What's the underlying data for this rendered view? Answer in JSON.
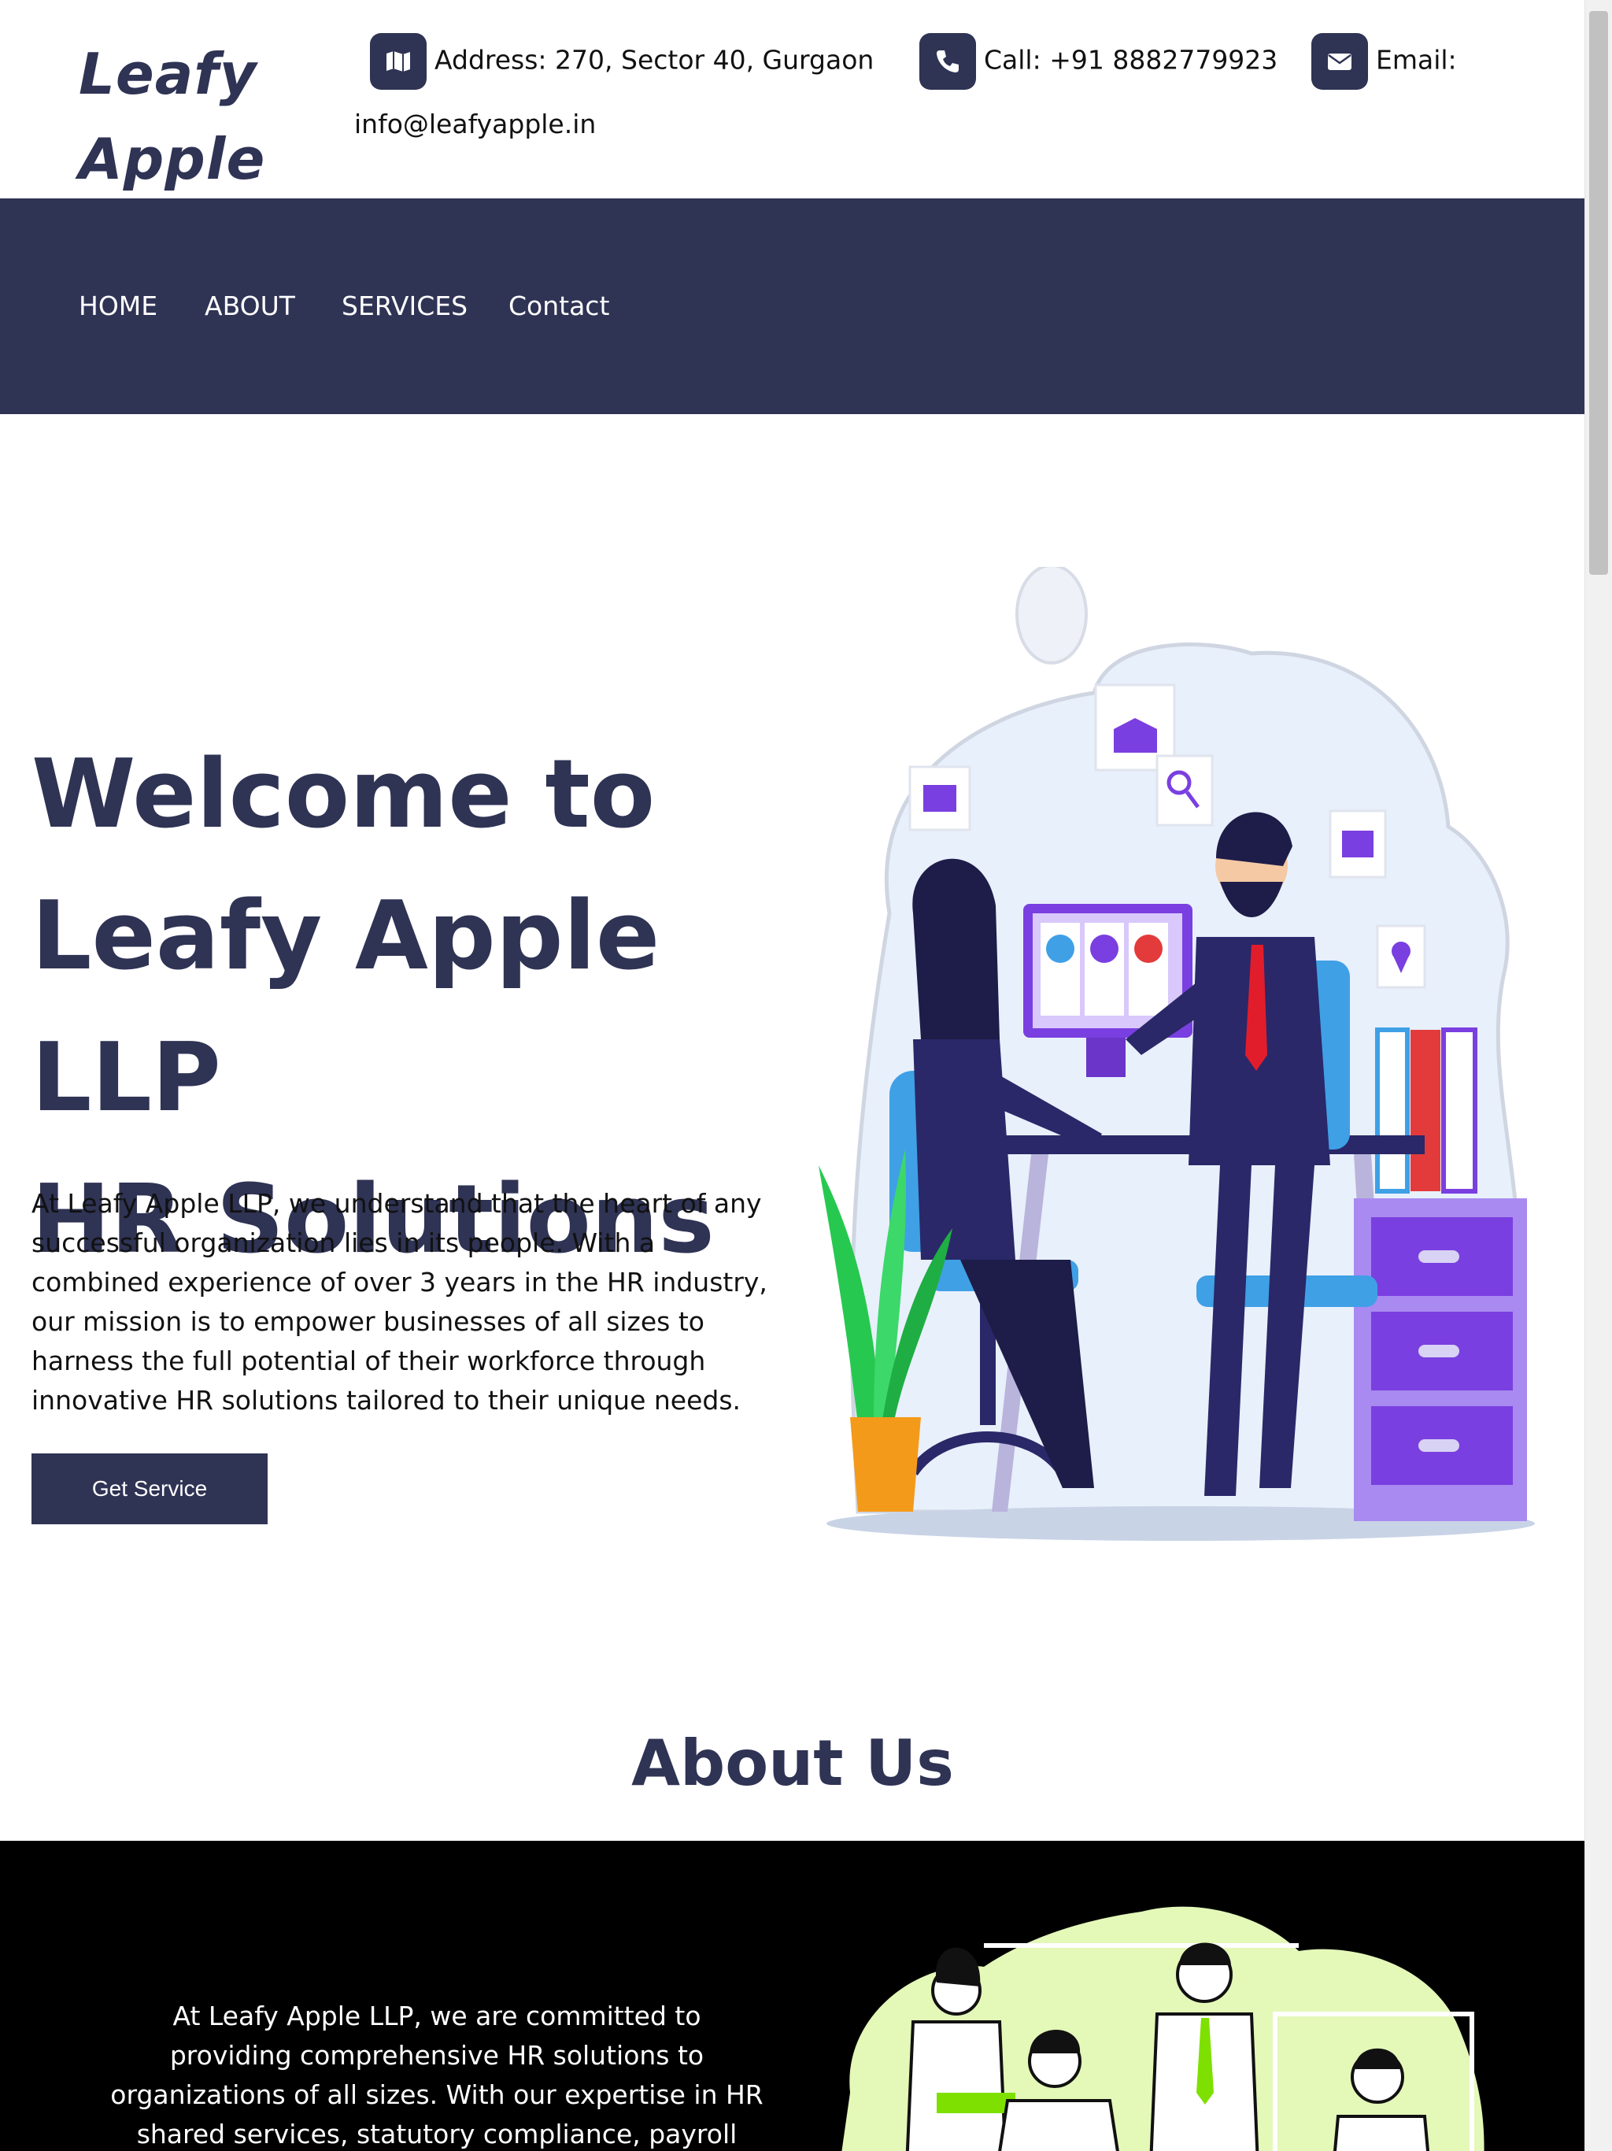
{
  "brand": {
    "logo_line1": "Leafy",
    "logo_line2": "Apple",
    "color": "#2f3354"
  },
  "contact": {
    "address_icon": "map-icon",
    "address": "Address: 270, Sector 40, Gurgaon",
    "call_icon": "phone-icon",
    "call": "Call: +91 8882779923",
    "email_icon": "envelope-icon",
    "email_label": "Email:",
    "email_value": "info@leafyapple.in"
  },
  "nav": {
    "items": [
      "HOME",
      "ABOUT",
      "SERVICES",
      "Contact"
    ]
  },
  "hero": {
    "title_lines": [
      "Welcome to",
      "Leafy Apple LLP",
      "HR Solutions"
    ],
    "description": "At Leafy Apple LLP, we understand that the heart of any successful organization lies in its people. With a combined experience of over 3 years in the HR industry, our mission is to empower businesses of all sizes to harness the full potential of their workforce through innovative HR solutions tailored to their unique needs.",
    "cta": "Get Service"
  },
  "about": {
    "title": "About Us",
    "text": "At Leafy Apple LLP, we are committed to providing comprehensive HR solutions to organizations of all sizes. With our expertise in HR shared services, statutory compliance, payroll outsourcing,"
  },
  "colors": {
    "primary": "#2f3354",
    "about_bg": "#000000",
    "accent_purple": "#7a3fe0",
    "accent_blue": "#3fa0e6",
    "accent_green": "#c9f28c"
  }
}
